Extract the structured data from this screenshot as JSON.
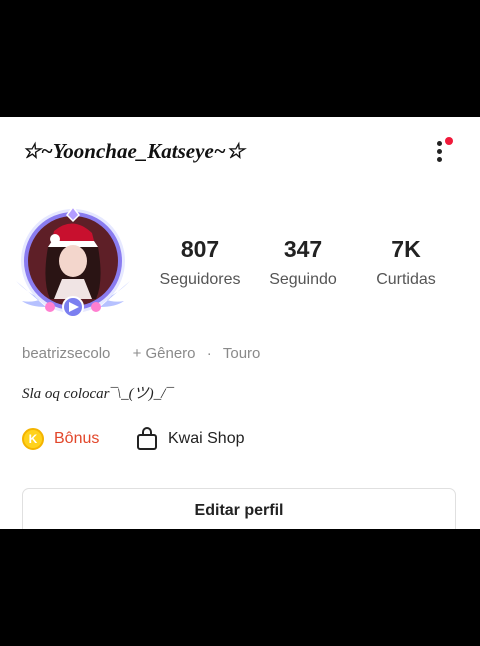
{
  "profile": {
    "title": "☆~Yoonchae_Katseye~☆",
    "stats": [
      {
        "value": "807",
        "label": "Seguidores"
      },
      {
        "value": "347",
        "label": "Seguindo"
      },
      {
        "value": "7K",
        "label": "Curtidas"
      }
    ],
    "username": "beatrizsecolo",
    "gender": "+ Gênero",
    "separator": "·",
    "sign": "Touro",
    "bio": "Sla oq colocar¯\\_(ツ)_/¯"
  },
  "actions": {
    "bonus_label": "Bônus",
    "bonus_coin": "K",
    "shop_label": "Kwai Shop",
    "edit_profile": "Editar perfil"
  },
  "icons": {
    "menu": "more-vertical-icon",
    "notification": "red-dot-badge",
    "coin": "k-coin-icon",
    "shop": "shopping-bag-icon"
  },
  "colors": {
    "bonus": "#e2472b",
    "coin": "#ffd21c",
    "badge": "#f0193a",
    "frame": "#7b7ff0"
  }
}
